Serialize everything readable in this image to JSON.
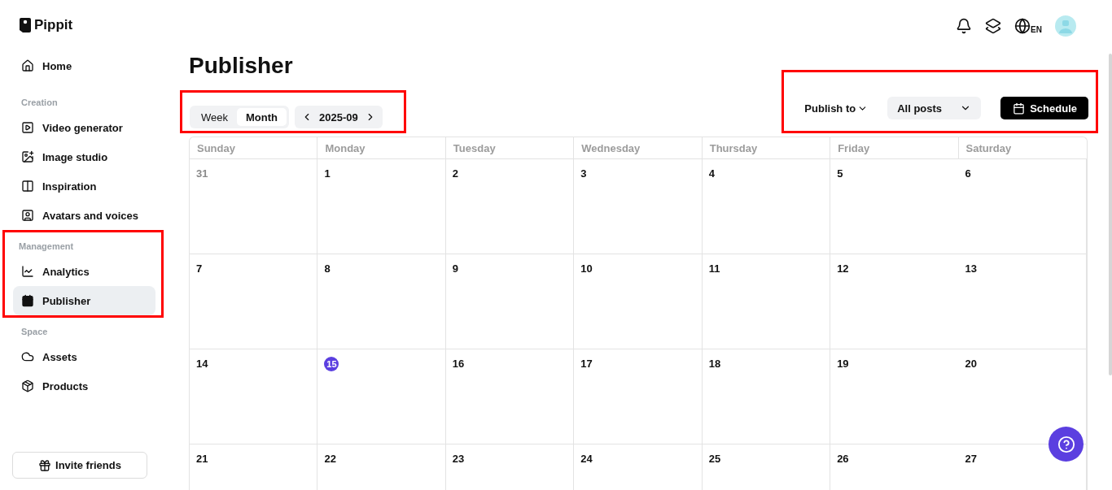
{
  "brand": {
    "name": "Pippit"
  },
  "sidebar": {
    "sections": [
      {
        "items": [
          {
            "label": "Home",
            "selected": false
          }
        ]
      },
      {
        "title": "Creation",
        "items": [
          {
            "label": "Video generator",
            "selected": false
          },
          {
            "label": "Image studio",
            "selected": false
          },
          {
            "label": "Inspiration",
            "selected": false
          },
          {
            "label": "Avatars and voices",
            "selected": false
          }
        ]
      },
      {
        "title": "Management",
        "highlighted": true,
        "items": [
          {
            "label": "Analytics",
            "selected": false
          },
          {
            "label": "Publisher",
            "selected": true
          }
        ]
      },
      {
        "title": "Space",
        "items": [
          {
            "label": "Assets",
            "selected": false
          },
          {
            "label": "Products",
            "selected": false
          }
        ]
      }
    ],
    "invite_button": "Invite friends"
  },
  "topbar": {
    "language": "EN"
  },
  "page": {
    "title": "Publisher"
  },
  "view_controls": {
    "highlighted": true,
    "views": [
      {
        "label": "Week",
        "selected": false
      },
      {
        "label": "Month",
        "selected": true
      }
    ],
    "period": "2025-09"
  },
  "actions": {
    "highlighted": true,
    "publish_to": "Publish to",
    "filter": "All posts",
    "schedule": "Schedule"
  },
  "calendar": {
    "weekdays": [
      "Sunday",
      "Monday",
      "Tuesday",
      "Wednesday",
      "Thursday",
      "Friday",
      "Saturday"
    ],
    "days": [
      {
        "label": "31",
        "outside": true,
        "today": false
      },
      {
        "label": "1",
        "outside": false,
        "today": false
      },
      {
        "label": "2",
        "outside": false,
        "today": false
      },
      {
        "label": "3",
        "outside": false,
        "today": false
      },
      {
        "label": "4",
        "outside": false,
        "today": false
      },
      {
        "label": "5",
        "outside": false,
        "today": false
      },
      {
        "label": "6",
        "outside": false,
        "today": false
      },
      {
        "label": "7",
        "outside": false,
        "today": false
      },
      {
        "label": "8",
        "outside": false,
        "today": false
      },
      {
        "label": "9",
        "outside": false,
        "today": false
      },
      {
        "label": "10",
        "outside": false,
        "today": false
      },
      {
        "label": "11",
        "outside": false,
        "today": false
      },
      {
        "label": "12",
        "outside": false,
        "today": false
      },
      {
        "label": "13",
        "outside": false,
        "today": false
      },
      {
        "label": "14",
        "outside": false,
        "today": false
      },
      {
        "label": "15",
        "outside": false,
        "today": true
      },
      {
        "label": "16",
        "outside": false,
        "today": false
      },
      {
        "label": "17",
        "outside": false,
        "today": false
      },
      {
        "label": "18",
        "outside": false,
        "today": false
      },
      {
        "label": "19",
        "outside": false,
        "today": false
      },
      {
        "label": "20",
        "outside": false,
        "today": false
      },
      {
        "label": "21",
        "outside": false,
        "today": false
      },
      {
        "label": "22",
        "outside": false,
        "today": false
      },
      {
        "label": "23",
        "outside": false,
        "today": false
      },
      {
        "label": "24",
        "outside": false,
        "today": false
      },
      {
        "label": "25",
        "outside": false,
        "today": false
      },
      {
        "label": "26",
        "outside": false,
        "today": false
      },
      {
        "label": "27",
        "outside": false,
        "today": false
      }
    ]
  }
}
